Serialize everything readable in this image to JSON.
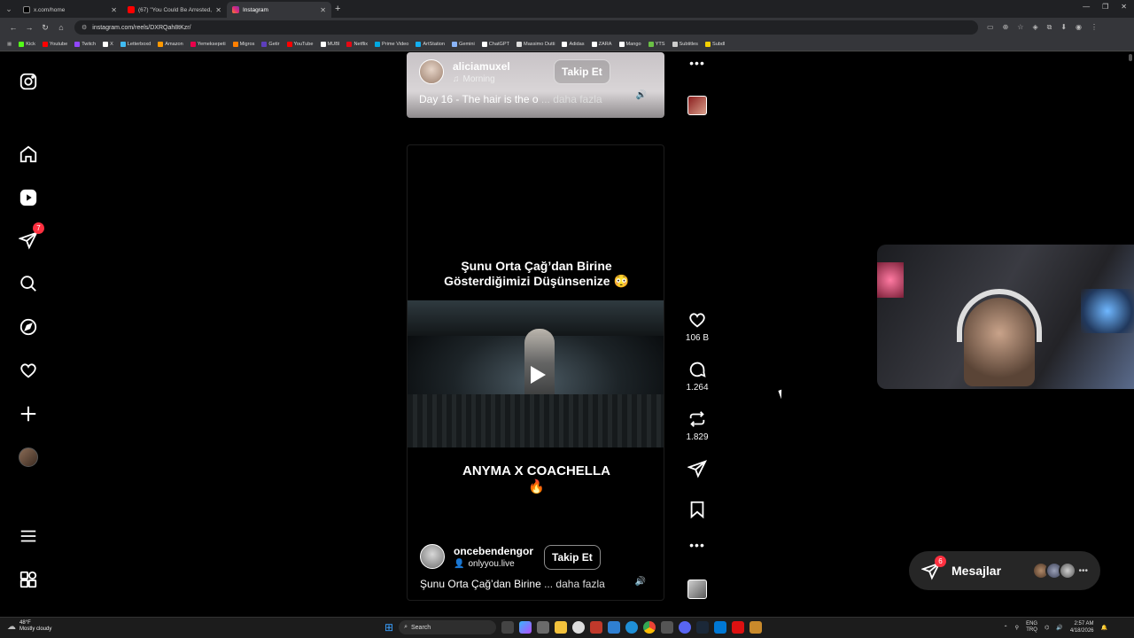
{
  "browser": {
    "tabs": [
      {
        "title": "x.com/home",
        "icon": "x-logo-icon",
        "color": "#000000",
        "active": false
      },
      {
        "title": "(67) \"You Could Be Arrested,\" I",
        "icon": "youtube-icon",
        "color": "#ff0000",
        "active": false
      },
      {
        "title": "Instagram",
        "icon": "instagram-icon",
        "color": "#e1306c",
        "active": true
      }
    ],
    "url": "instagram.com/reels/DXRQah8tKzr/",
    "bookmarks": [
      {
        "label": "Kick",
        "color": "#53fc18"
      },
      {
        "label": "Youtube",
        "color": "#ff0000"
      },
      {
        "label": "Twitch",
        "color": "#9146ff"
      },
      {
        "label": "X",
        "color": "#ffffff"
      },
      {
        "label": "Letterboxd",
        "color": "#40bcf4"
      },
      {
        "label": "Amazon",
        "color": "#ff9900"
      },
      {
        "label": "Yemeksepeti",
        "color": "#ea004b"
      },
      {
        "label": "Migros",
        "color": "#ff7f00"
      },
      {
        "label": "Getir",
        "color": "#5d3ebc"
      },
      {
        "label": "YouTube",
        "color": "#ff0000"
      },
      {
        "label": "MUBI",
        "color": "#ffffff"
      },
      {
        "label": "Netflix",
        "color": "#e50914"
      },
      {
        "label": "Prime Video",
        "color": "#00a8e1"
      },
      {
        "label": "ArtStation",
        "color": "#13aff0"
      },
      {
        "label": "Gemini",
        "color": "#8ab4f8"
      },
      {
        "label": "ChatGPT",
        "color": "#ffffff"
      },
      {
        "label": "Massimo Dutti",
        "color": "#dddddd"
      },
      {
        "label": "Adidas",
        "color": "#ffffff"
      },
      {
        "label": "ZARA",
        "color": "#ffffff"
      },
      {
        "label": "Mango",
        "color": "#ffffff"
      },
      {
        "label": "YTS",
        "color": "#6ac045"
      },
      {
        "label": "Subtitles",
        "color": "#cccccc"
      },
      {
        "label": "Subdl",
        "color": "#f5d000"
      }
    ]
  },
  "nav": {
    "messages_badge": "7"
  },
  "reel_top": {
    "username": "aliciamuxel",
    "audio": "Morning",
    "follow_label": "Takip Et",
    "caption": "Day 16 - The hair is the o",
    "more_label": "... daha fazla"
  },
  "reel_main": {
    "overlay_line1": "Şunu Orta Çağ’dan Birine",
    "overlay_line2": "Gösterdiğimizi Düşünsenize 😳",
    "title_line1": "ANYMA X COACHELLA",
    "title_line2": "🔥",
    "username": "oncebendengor",
    "audio": "onlyyou.live",
    "follow_label": "Takip Et",
    "caption": "Şunu Orta Çağ’dan Birine",
    "more_label": "... daha fazla"
  },
  "actions": {
    "likes": "106 B",
    "comments": "1.264",
    "reposts": "1.829"
  },
  "messages_bar": {
    "label": "Mesajlar",
    "badge": "6"
  },
  "taskbar": {
    "temperature": "48°F",
    "weather": "Mostly cloudy",
    "search": "Search",
    "lang_top": "ENG",
    "lang_bottom": "TRQ",
    "time": "2:57 AM",
    "date": "4/18/2026"
  },
  "colors": {
    "accent_red": "#ff3040",
    "background": "#000000"
  }
}
